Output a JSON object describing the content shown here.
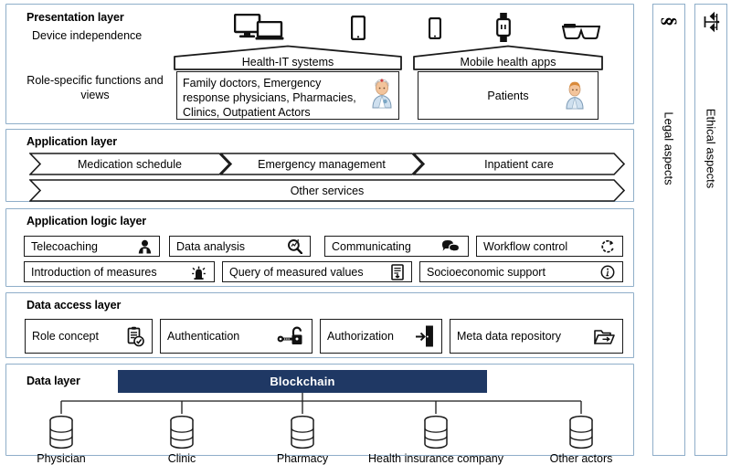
{
  "presentation": {
    "title": "Presentation layer",
    "subtitle_top": "Device independence",
    "subtitle_bottom": "Role-specific functions and views",
    "devices_left": [
      "desktop-monitor-icon",
      "laptop-icon",
      "tablet-icon"
    ],
    "devices_right": [
      "smartphone-icon",
      "smartwatch-icon",
      "smart-glasses-icon"
    ],
    "groups": [
      {
        "roof_label": "Health-IT systems",
        "occupant_text": "Family doctors, Emergency response physicians, Pharmacies, Clinics, Outpatient Actors",
        "avatar": "doctor-avatar"
      },
      {
        "roof_label": "Mobile health apps",
        "occupant_text": "Patients",
        "avatar": "patient-avatar"
      }
    ]
  },
  "application": {
    "title": "Application layer",
    "services": [
      "Medication schedule",
      "Emergency management",
      "Inpatient care"
    ],
    "other_service": "Other services"
  },
  "logic": {
    "title": "Application logic layer",
    "row1": [
      {
        "label": "Telecoaching",
        "icon": "person-icon"
      },
      {
        "label": "Data analysis",
        "icon": "magnifier-icon"
      },
      {
        "label": "Communicating",
        "icon": "speech-bubbles-icon"
      },
      {
        "label": "Workflow control",
        "icon": "refresh-cycle-icon"
      }
    ],
    "row2": [
      {
        "label": "Introduction of measures",
        "icon": "alarm-siren-icon"
      },
      {
        "label": "Query of measured values",
        "icon": "document-arrow-icon"
      },
      {
        "label": "Socioeconomic support",
        "icon": "info-circle-icon"
      }
    ]
  },
  "access": {
    "title": "Data access layer",
    "items": [
      {
        "label": "Role concept",
        "icon": "clipboard-check-icon"
      },
      {
        "label": "Authentication",
        "icon": "key-padlock-icon"
      },
      {
        "label": "Authorization",
        "icon": "door-entry-icon"
      },
      {
        "label": "Meta data repository",
        "icon": "open-folder-icon"
      }
    ]
  },
  "data": {
    "title": "Data layer",
    "blockchain": "Blockchain",
    "nodes": [
      "Physician",
      "Clinic",
      "Pharmacy",
      "Health insurance company",
      "Other actors"
    ]
  },
  "aspects": [
    {
      "label": "Legal aspects",
      "icon": "section-sign-icon"
    },
    {
      "label": "Ethical aspects",
      "icon": "scales-of-justice-icon"
    }
  ],
  "colors": {
    "layer_border": "#8faec9",
    "shape_stroke": "#1a1a1a",
    "blockchain_fill": "#1f3864",
    "blockchain_text": "#ffffff",
    "background": "#ffffff"
  }
}
